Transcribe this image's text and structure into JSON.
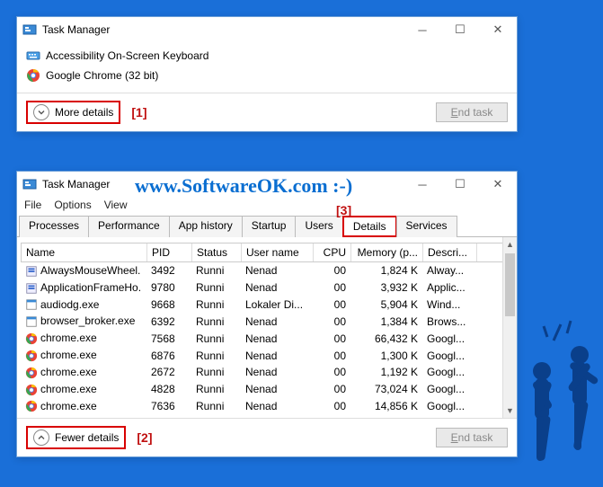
{
  "watermark": "www.SoftwareOK.com :-)",
  "callouts": {
    "c1": "[1]",
    "c2": "[2]",
    "c3": "[3]"
  },
  "simple_window": {
    "title": "Task Manager",
    "rows": [
      {
        "icon": "keyboard",
        "name": "Accessibility On-Screen Keyboard"
      },
      {
        "icon": "chrome",
        "name": "Google Chrome (32 bit)"
      }
    ],
    "toggle_label": "More details",
    "end_task": "End task"
  },
  "detail_window": {
    "title": "Task Manager",
    "menu": [
      "File",
      "Options",
      "View"
    ],
    "tabs": [
      "Processes",
      "Performance",
      "App history",
      "Startup",
      "Users",
      "Details",
      "Services"
    ],
    "active_tab": "Details",
    "columns": [
      "Name",
      "PID",
      "Status",
      "User name",
      "CPU",
      "Memory (p...",
      "Descri..."
    ],
    "rows": [
      {
        "icon": "app",
        "name": "AlwaysMouseWheel.",
        "pid": "3492",
        "status": "Runni",
        "user": "Nenad",
        "cpu": "00",
        "mem": "1,824 K",
        "desc": "Alway..."
      },
      {
        "icon": "app",
        "name": "ApplicationFrameHo.",
        "pid": "9780",
        "status": "Runni",
        "user": "Nenad",
        "cpu": "00",
        "mem": "3,932 K",
        "desc": "Applic..."
      },
      {
        "icon": "exe",
        "name": "audiodg.exe",
        "pid": "9668",
        "status": "Runni",
        "user": "Lokaler Di...",
        "cpu": "00",
        "mem": "5,904 K",
        "desc": "Wind..."
      },
      {
        "icon": "exe",
        "name": "browser_broker.exe",
        "pid": "6392",
        "status": "Runni",
        "user": "Nenad",
        "cpu": "00",
        "mem": "1,384 K",
        "desc": "Brows..."
      },
      {
        "icon": "chrome",
        "name": "chrome.exe",
        "pid": "7568",
        "status": "Runni",
        "user": "Nenad",
        "cpu": "00",
        "mem": "66,432 K",
        "desc": "Googl..."
      },
      {
        "icon": "chrome",
        "name": "chrome.exe",
        "pid": "6876",
        "status": "Runni",
        "user": "Nenad",
        "cpu": "00",
        "mem": "1,300 K",
        "desc": "Googl..."
      },
      {
        "icon": "chrome",
        "name": "chrome.exe",
        "pid": "2672",
        "status": "Runni",
        "user": "Nenad",
        "cpu": "00",
        "mem": "1,192 K",
        "desc": "Googl..."
      },
      {
        "icon": "chrome",
        "name": "chrome.exe",
        "pid": "4828",
        "status": "Runni",
        "user": "Nenad",
        "cpu": "00",
        "mem": "73,024 K",
        "desc": "Googl..."
      },
      {
        "icon": "chrome",
        "name": "chrome.exe",
        "pid": "7636",
        "status": "Runni",
        "user": "Nenad",
        "cpu": "00",
        "mem": "14,856 K",
        "desc": "Googl..."
      }
    ],
    "toggle_label": "Fewer details",
    "end_task": "End task"
  }
}
